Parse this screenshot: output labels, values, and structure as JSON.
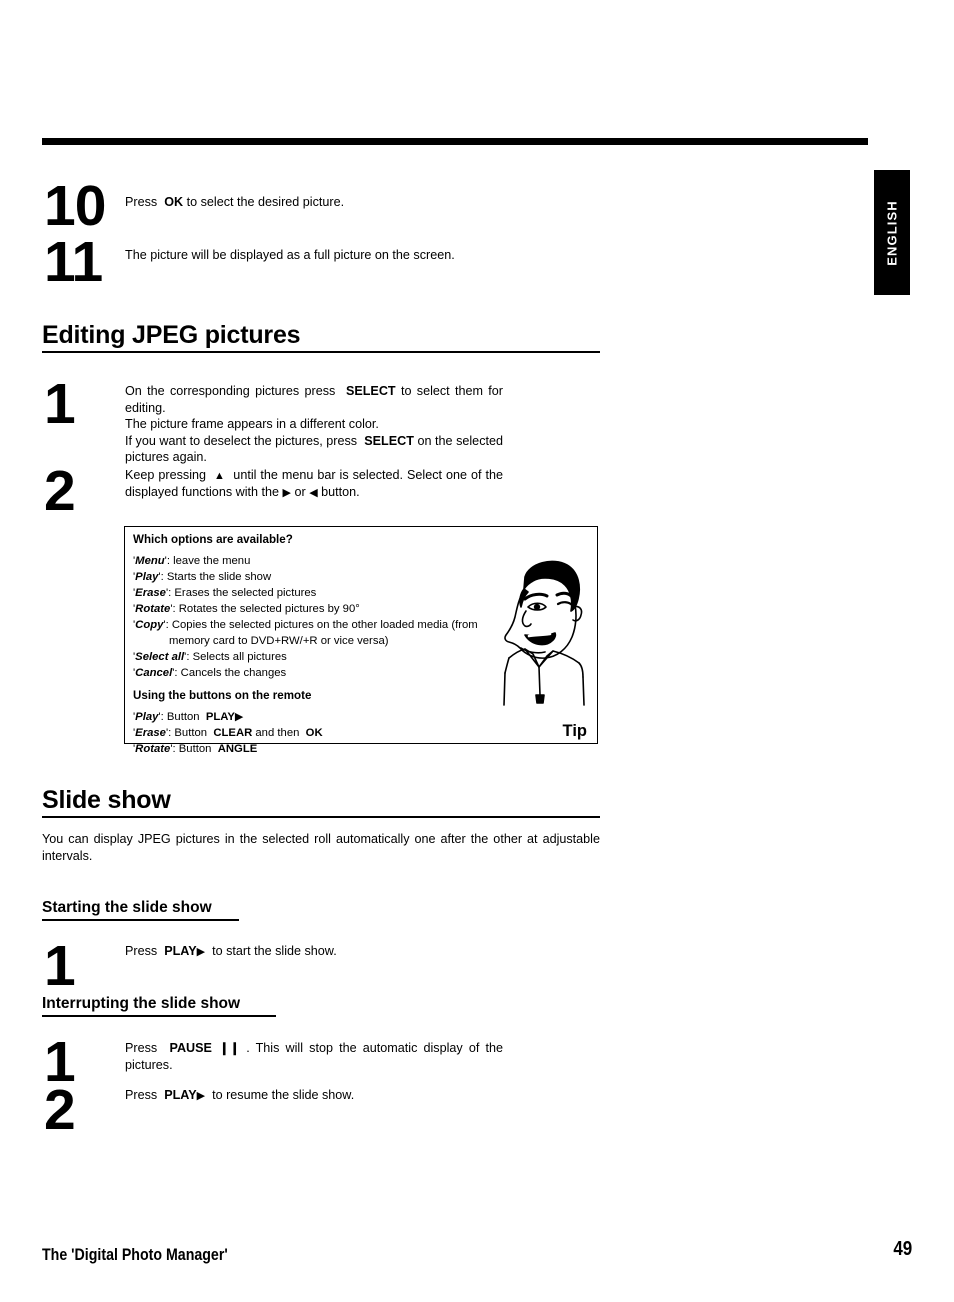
{
  "language_tab": {
    "label": "ENGLISH"
  },
  "top_steps": [
    {
      "number": "10",
      "text_html": "Press&nbsp; <b>OK</b> to select the desired picture."
    },
    {
      "number": "11",
      "text_html": "The picture will be displayed as a full picture on the screen."
    }
  ],
  "section_editing": {
    "heading": "Editing JPEG pictures",
    "steps": [
      {
        "number": "1",
        "text_html": "On the corresponding pictures press&nbsp; <b>SELECT</b> to select them for editing.<br>The picture frame appears in a different color.<br>If you want to deselect the pictures, press&nbsp; <b>SELECT</b> on the selected pictures again."
      },
      {
        "number": "2",
        "text_html": "Keep pressing&nbsp; <span class=\"tri\">&#9650;</span> &nbsp;until the menu bar is selected. Select one of the displayed functions with the <span class=\"tri\">&#9654;</span> or <span class=\"tri\">&#9664;</span> button."
      }
    ]
  },
  "tip_box": {
    "title": "Which options are available?",
    "options": [
      {
        "name": "Menu",
        "desc": ": leave the menu"
      },
      {
        "name": "Play",
        "desc": ": Starts the slide show"
      },
      {
        "name": "Erase",
        "desc": ": Erases the selected pictures"
      },
      {
        "name": "Rotate",
        "desc": ": Rotates the selected pictures by 90°"
      },
      {
        "name": "Copy",
        "desc": ": Copies the selected pictures on the other loaded media (from",
        "continuation": "memory card to DVD+RW/+R or vice versa)"
      },
      {
        "name": "Select all",
        "desc": ": Selects all pictures"
      },
      {
        "name": "Cancel",
        "desc": ": Cancels the changes"
      }
    ],
    "subtitle": "Using the buttons on the remote",
    "remote_buttons": [
      {
        "name": "Play",
        "desc_html": ": Button&nbsp; <b>PLAY</b><span class=\"tri\">&#9654;</span>"
      },
      {
        "name": "Erase",
        "desc_html": ": Button&nbsp; <b>CLEAR</b> and then&nbsp; <b>OK</b>"
      },
      {
        "name": "Rotate",
        "desc_html": ": Button&nbsp; <b>ANGLE</b>"
      }
    ],
    "tip_label": "Tip",
    "illustration": "tip-character-face"
  },
  "section_slideshow": {
    "heading": "Slide show",
    "intro": "You can display JPEG pictures in the selected roll automatically one after the other at adjustable intervals.",
    "subsection_start": {
      "heading": "Starting the slide show",
      "steps": [
        {
          "number": "1",
          "text_html": "Press&nbsp; <b>PLAY</b><span class=\"tri\">&#9654;</span>&nbsp; to start the slide show."
        }
      ]
    },
    "subsection_interrupt": {
      "heading": "Interrupting the slide show",
      "steps": [
        {
          "number": "1",
          "text_html": "Press&nbsp; <b>PAUSE&#8199;&#10073;&#10073;</b>&nbsp;. This will stop the automatic display of the pictures."
        },
        {
          "number": "2",
          "text_html": "Press&nbsp; <b>PLAY</b><span class=\"tri\">&#9654;</span>&nbsp; to resume the slide show."
        }
      ]
    }
  },
  "footer": {
    "title": "The 'Digital Photo Manager'",
    "page_number": "49"
  }
}
